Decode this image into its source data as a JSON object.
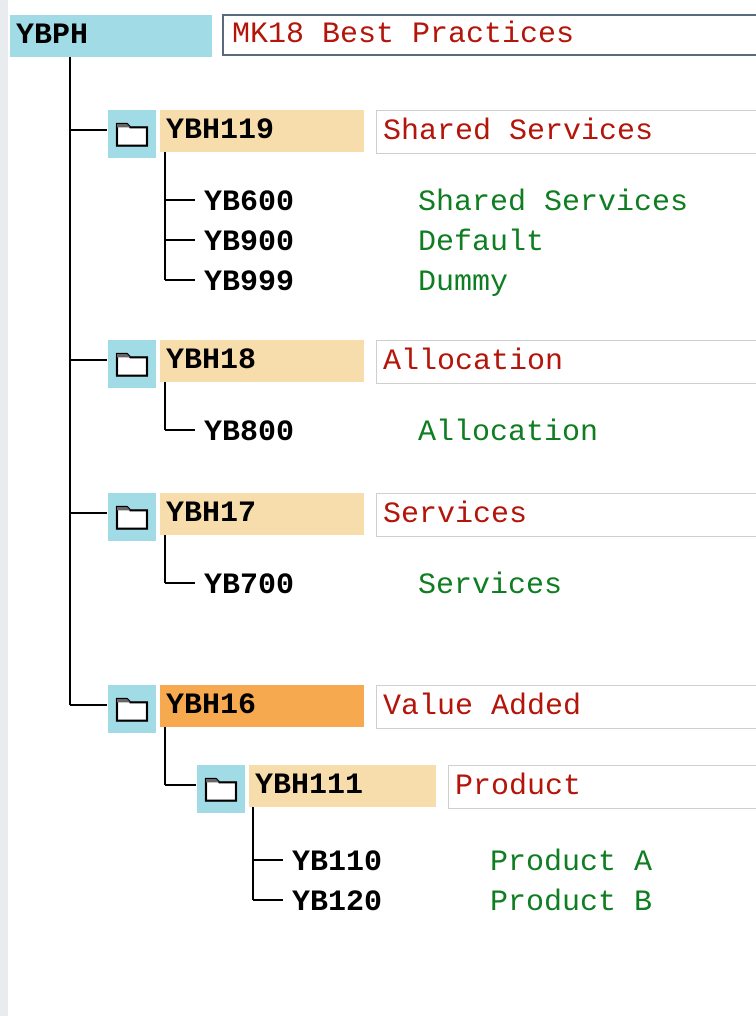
{
  "root": {
    "code": "YBPH",
    "desc": "MK18 Best Practices"
  },
  "groups": [
    {
      "code": "YBH119",
      "desc": "Shared Services",
      "children": [
        {
          "code": "YB600",
          "desc": "Shared Services"
        },
        {
          "code": "YB900",
          "desc": "Default"
        },
        {
          "code": "YB999",
          "desc": "Dummy"
        }
      ]
    },
    {
      "code": "YBH18",
      "desc": "Allocation",
      "children": [
        {
          "code": "YB800",
          "desc": "Allocation"
        }
      ]
    },
    {
      "code": "YBH17",
      "desc": "Services",
      "children": [
        {
          "code": "YB700",
          "desc": "Services"
        }
      ]
    },
    {
      "code": "YBH16",
      "desc": "Value Added",
      "highlight": true,
      "subgroups": [
        {
          "code": "YBH111",
          "desc": "Product",
          "children": [
            {
              "code": "YB110",
              "desc": "Product A"
            },
            {
              "code": "YB120",
              "desc": "Product B"
            }
          ]
        }
      ]
    }
  ]
}
